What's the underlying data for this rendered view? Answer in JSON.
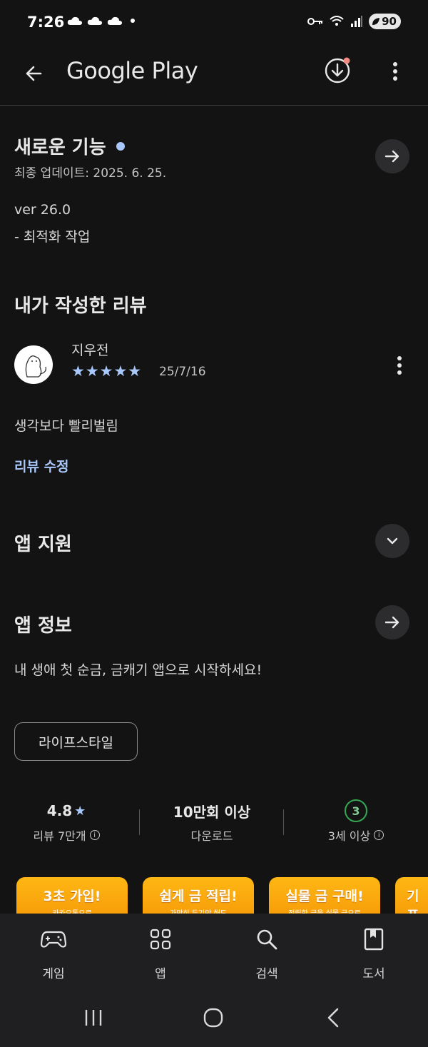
{
  "status_bar": {
    "time": "7:26",
    "battery": "90"
  },
  "app_bar": {
    "title": "Google Play"
  },
  "whats_new": {
    "title": "새로운 기능",
    "updated": "최종 업데이트: 2025. 6. 25.",
    "version": "ver 26.0",
    "notes": "- 최적화 작업"
  },
  "my_review": {
    "title": "내가 작성한 리뷰",
    "author": "지우전",
    "stars": "★★★★★",
    "rating": 5,
    "date": "25/7/16",
    "text": "생각보다 빨리벌림",
    "edit_label": "리뷰 수정"
  },
  "app_support": {
    "title": "앱 지원"
  },
  "app_info": {
    "title": "앱 정보",
    "description": "내 생애 첫 순금, 금캐기 앱으로 시작하세요!",
    "category_chip": "라이프스타일"
  },
  "stats": {
    "rating": "4.8",
    "rating_star": "★",
    "reviews_label": "리뷰 7만개",
    "downloads": "10만회 이상",
    "downloads_label": "다운로드",
    "age_rating": "3",
    "age_label": "3세 이상",
    "info_symbol": "i"
  },
  "screenshots": [
    {
      "title": "3초 가입!",
      "subtitle": "카카오톡으로"
    },
    {
      "title": "쉽게 금 적립!",
      "subtitle": "가만히 두기만 해도"
    },
    {
      "title": "실물 금 구매!",
      "subtitle": "적립한 금을 실물 금으로"
    },
    {
      "title": "기프",
      "subtitle": ""
    }
  ],
  "bottom_nav": {
    "games": "게임",
    "apps": "앱",
    "search": "검색",
    "books": "도서"
  },
  "colors": {
    "background": "#131313",
    "accent_blue": "#a8c7fa",
    "age_green": "#34a853",
    "screenshot_orange": "#fdb714"
  }
}
